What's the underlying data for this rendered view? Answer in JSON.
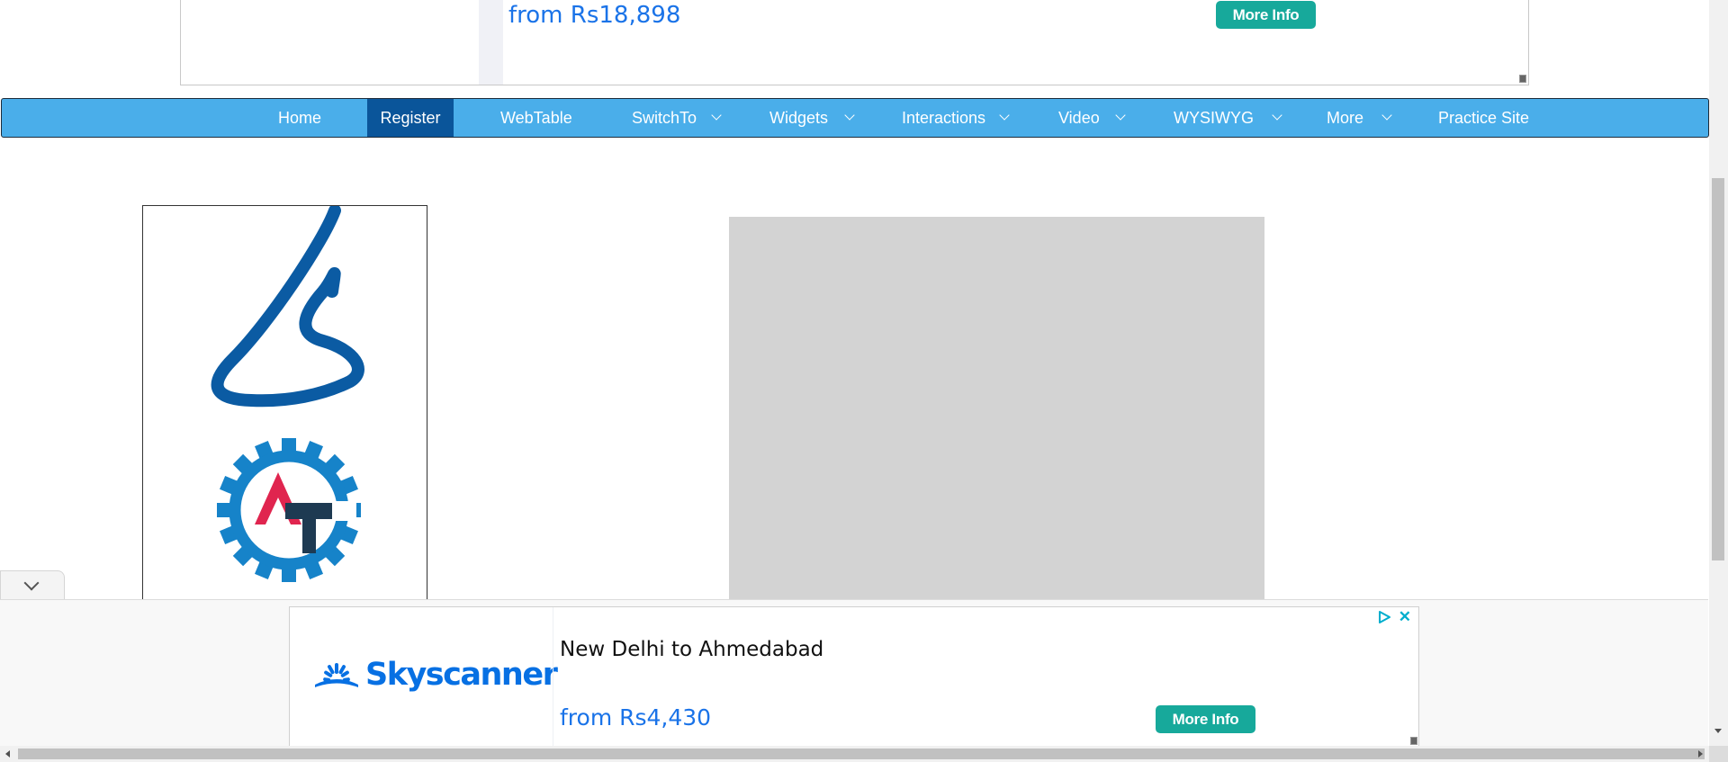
{
  "top_ad": {
    "price": "from Rs18,898",
    "button": "More Info"
  },
  "nav": {
    "items": [
      {
        "label": "Home",
        "dropdown": false,
        "active": false
      },
      {
        "label": "Register",
        "dropdown": false,
        "active": true
      },
      {
        "label": "WebTable",
        "dropdown": false,
        "active": false
      },
      {
        "label": "SwitchTo",
        "dropdown": true,
        "active": false
      },
      {
        "label": "Widgets",
        "dropdown": true,
        "active": false
      },
      {
        "label": "Interactions",
        "dropdown": true,
        "active": false
      },
      {
        "label": "Video",
        "dropdown": true,
        "active": false
      },
      {
        "label": "WYSIWYG",
        "dropdown": true,
        "active": false
      },
      {
        "label": "More",
        "dropdown": true,
        "active": false
      },
      {
        "label": "Practice Site",
        "dropdown": false,
        "active": false
      }
    ]
  },
  "colors": {
    "nav_bg": "#4aaeea",
    "nav_active": "#0a559a",
    "button": "#17a99b",
    "price": "#1a73e8",
    "logo_s": "#0b5ba3",
    "logo_gear": "#1683c9",
    "logo_a": "#e0254f",
    "logo_t": "#1e3a52"
  },
  "icons": {
    "collapse": "chevron-down-icon",
    "ad_choices": "ad-choices-icon",
    "close": "close-icon"
  },
  "bottom_ad": {
    "brand": "Skyscanner",
    "title": "New Delhi to Ahmedabad",
    "price": "from Rs4,430",
    "button": "More Info",
    "close": "✕"
  }
}
